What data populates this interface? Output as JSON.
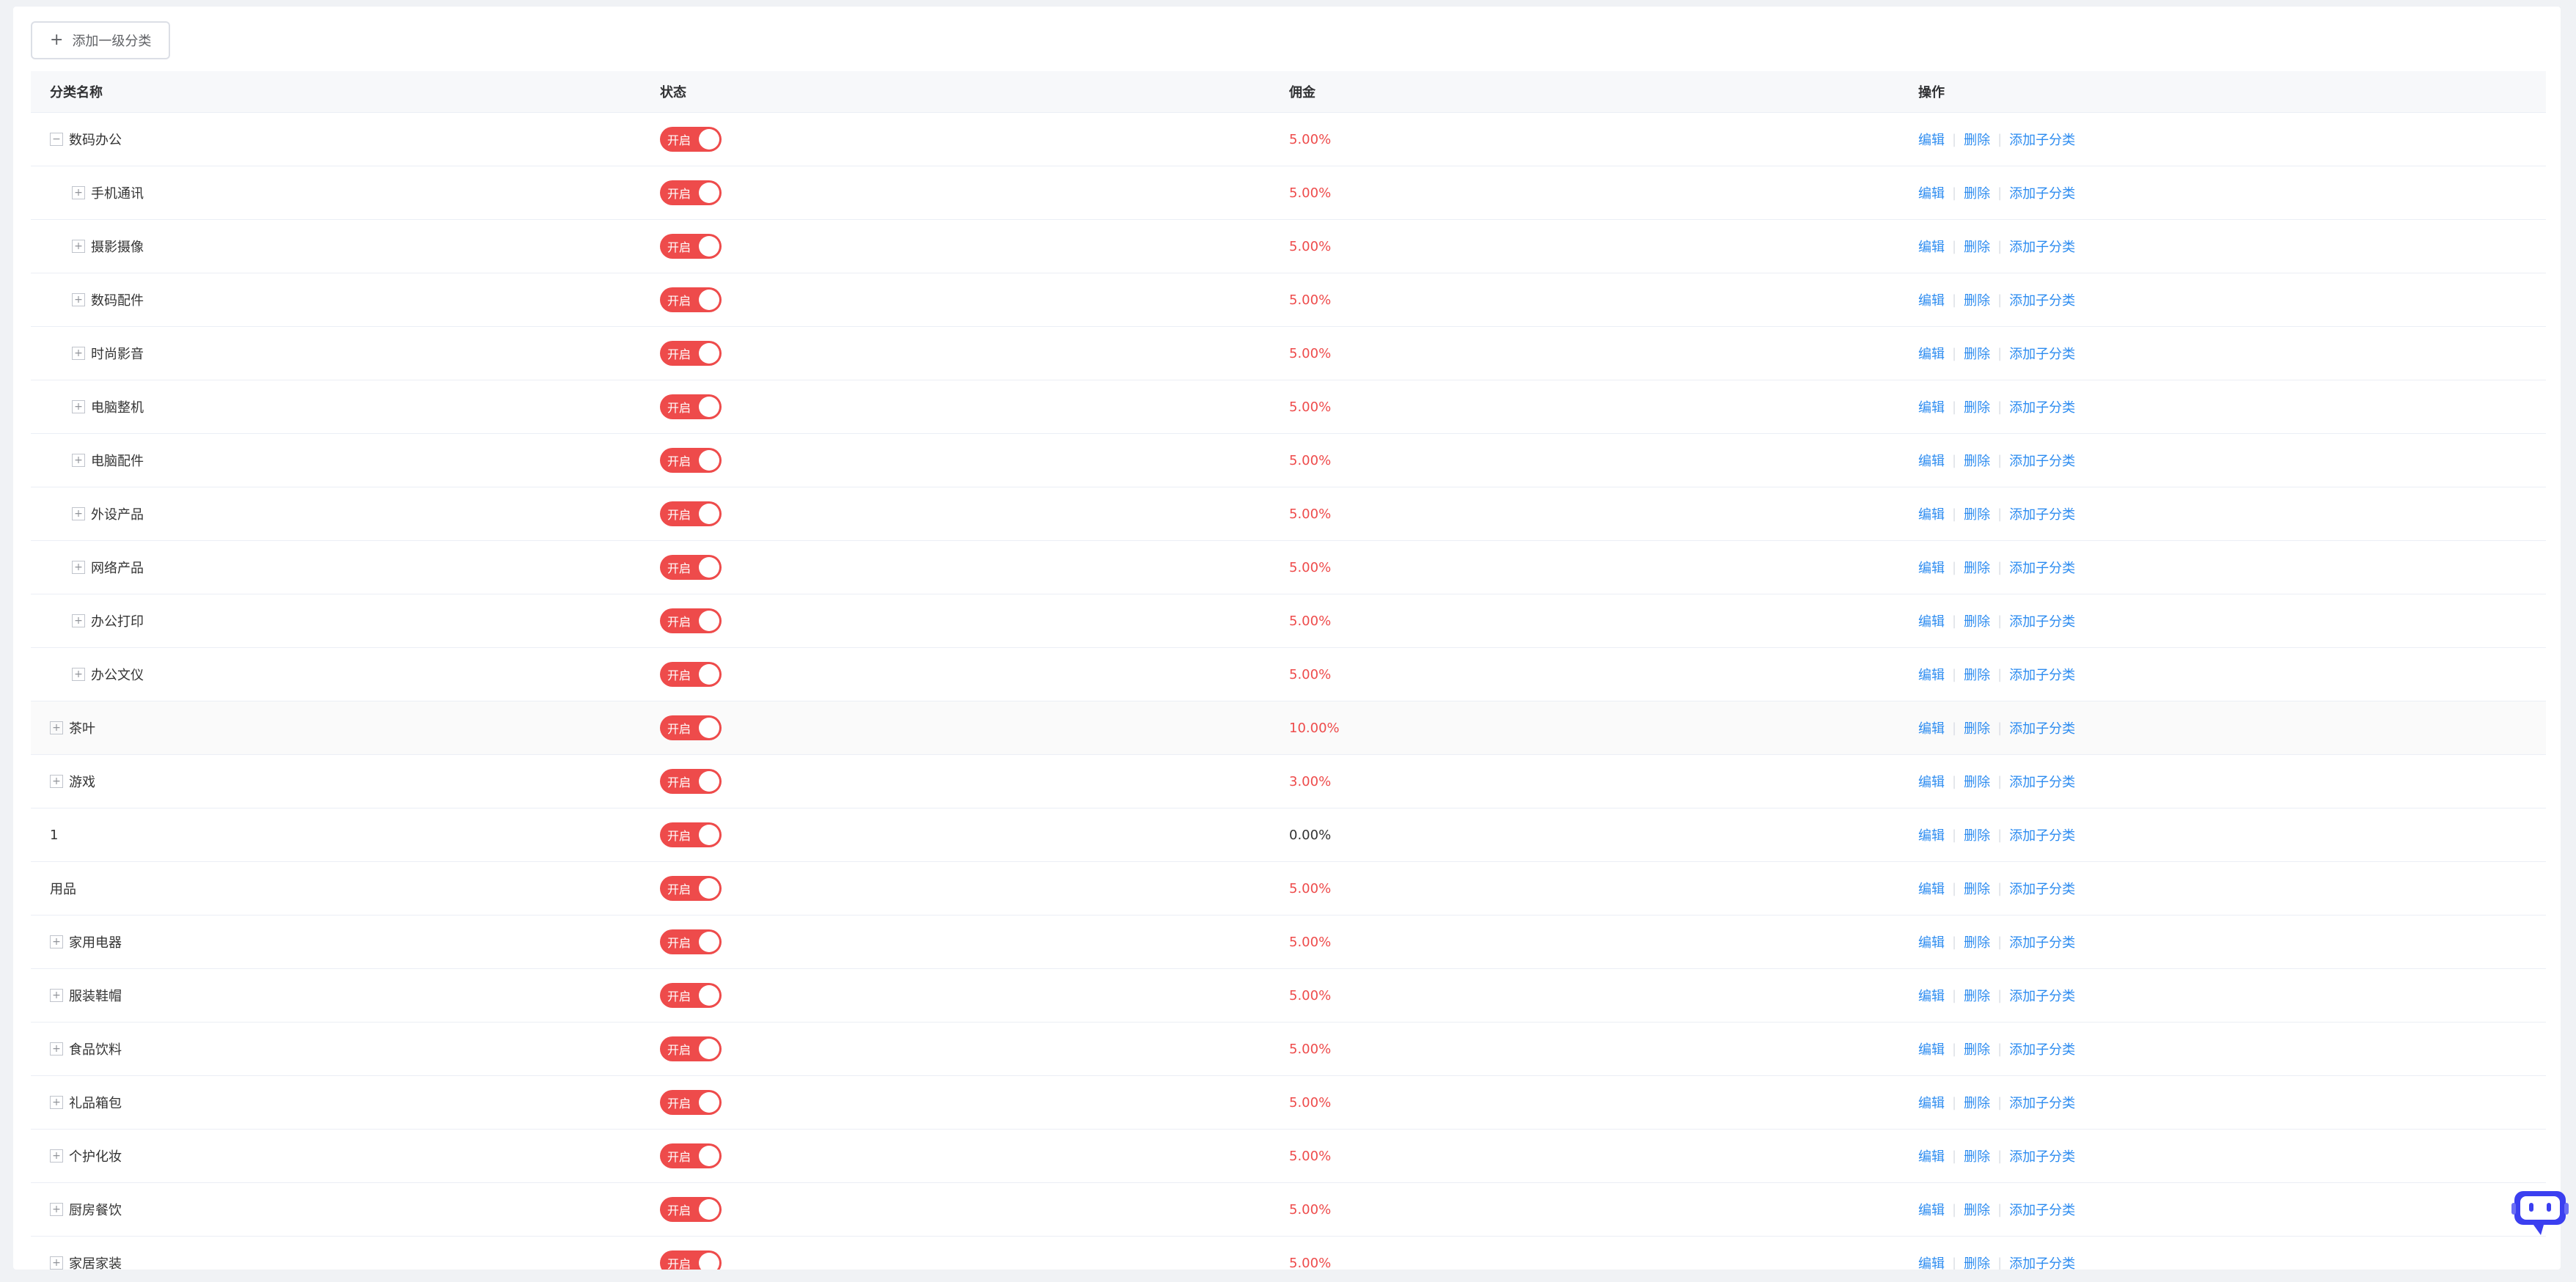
{
  "toolbar": {
    "add_label": "添加一级分类",
    "add_icon": "plus-icon"
  },
  "table": {
    "headers": [
      "分类名称",
      "状态",
      "佣金",
      "操作"
    ],
    "switch_on_label": "开启",
    "actions": {
      "edit": "编辑",
      "delete": "删除",
      "add_child": "添加子分类"
    },
    "rows": [
      {
        "name": "数码办公",
        "level": 0,
        "expander": "−",
        "status": "开启",
        "commission": "5.00%"
      },
      {
        "name": "手机通讯",
        "level": 1,
        "expander": "+",
        "status": "开启",
        "commission": "5.00%"
      },
      {
        "name": "摄影摄像",
        "level": 1,
        "expander": "+",
        "status": "开启",
        "commission": "5.00%"
      },
      {
        "name": "数码配件",
        "level": 1,
        "expander": "+",
        "status": "开启",
        "commission": "5.00%"
      },
      {
        "name": "时尚影音",
        "level": 1,
        "expander": "+",
        "status": "开启",
        "commission": "5.00%"
      },
      {
        "name": "电脑整机",
        "level": 1,
        "expander": "+",
        "status": "开启",
        "commission": "5.00%"
      },
      {
        "name": "电脑配件",
        "level": 1,
        "expander": "+",
        "status": "开启",
        "commission": "5.00%"
      },
      {
        "name": "外设产品",
        "level": 1,
        "expander": "+",
        "status": "开启",
        "commission": "5.00%"
      },
      {
        "name": "网络产品",
        "level": 1,
        "expander": "+",
        "status": "开启",
        "commission": "5.00%"
      },
      {
        "name": "办公打印",
        "level": 1,
        "expander": "+",
        "status": "开启",
        "commission": "5.00%"
      },
      {
        "name": "办公文仪",
        "level": 1,
        "expander": "+",
        "status": "开启",
        "commission": "5.00%"
      },
      {
        "name": "茶叶",
        "level": 0,
        "expander": "+",
        "status": "开启",
        "commission": "10.00%",
        "hover": true
      },
      {
        "name": "游戏",
        "level": 0,
        "expander": "+",
        "status": "开启",
        "commission": "3.00%"
      },
      {
        "name": "1",
        "level": 0,
        "expander": "",
        "status": "开启",
        "commission": "0.00%"
      },
      {
        "name": "用品",
        "level": 0,
        "expander": "",
        "status": "开启",
        "commission": "5.00%"
      },
      {
        "name": "家用电器",
        "level": 0,
        "expander": "+",
        "status": "开启",
        "commission": "5.00%"
      },
      {
        "name": "服装鞋帽",
        "level": 0,
        "expander": "+",
        "status": "开启",
        "commission": "5.00%"
      },
      {
        "name": "食品饮料",
        "level": 0,
        "expander": "+",
        "status": "开启",
        "commission": "5.00%"
      },
      {
        "name": "礼品箱包",
        "level": 0,
        "expander": "+",
        "status": "开启",
        "commission": "5.00%"
      },
      {
        "name": "个护化妆",
        "level": 0,
        "expander": "+",
        "status": "开启",
        "commission": "5.00%"
      },
      {
        "name": "厨房餐饮",
        "level": 0,
        "expander": "+",
        "status": "开启",
        "commission": "5.00%"
      },
      {
        "name": "家居家装",
        "level": 0,
        "expander": "+",
        "status": "开启",
        "commission": "5.00%"
      }
    ]
  },
  "colors": {
    "accent": "#ee4b4b",
    "link": "#2d8cf0"
  },
  "chat_bot": {
    "icon": "robot-chat-icon"
  }
}
